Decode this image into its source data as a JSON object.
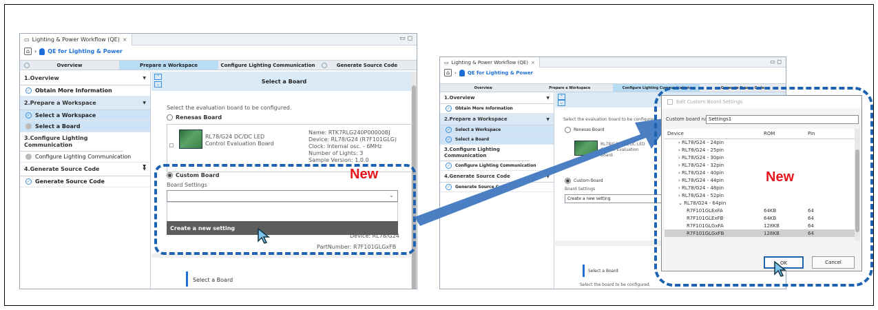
{
  "left": {
    "tab_title": "Lighting & Power Workflow (QE)",
    "tab_close": "×",
    "window_controls": "▭ ◻",
    "app_title": "QE for Lighting & Power",
    "steps": [
      "Overview",
      "Prepare a Workspace",
      "Configure Lighting Communication",
      "Generate Source Code"
    ],
    "sections": [
      {
        "label": "1.Overview",
        "items": [
          "Obtain More Information"
        ]
      },
      {
        "label": "2.Prepare a Workspace",
        "items": [
          "Select a Workspace",
          "Select a Board"
        ]
      },
      {
        "label": "3.Configure Lighting Communication",
        "items": [
          "Configure Lighting Communication"
        ]
      },
      {
        "label": "4.Generate Source Code",
        "items": [
          "Generate Source Code"
        ]
      }
    ],
    "header": "Select a Board",
    "instruction": "Select the evaluation board to be configured.",
    "renesas_board": "Renesas Board",
    "board_desc": "RL78/G24 DC/DC LED Control Evaluation Board",
    "board_info": [
      "Name: RTK7RLG240P00000BJ",
      "Device: RL78/G24 (R7F101GLG)",
      "Clock: Internal osc. - 6MHz",
      "Number of Lights: 3",
      "Sample Version: 1.0.0"
    ],
    "custom_board": "Custom Board",
    "board_settings": "Board Settings",
    "menu_item": "Create a new setting",
    "device_tail": "Device: RL78/G24",
    "part_number": "PartNumber: R7F101GLGxFB",
    "bottom_heading": "Select a Board",
    "new_label": "New"
  },
  "right": {
    "tab_title": "Lighting & Power Workflow (QE)",
    "tab_close": "×",
    "window_controls": "▭ ◻",
    "app_title": "QE for Lighting & Power",
    "steps": [
      "Overview",
      "Prepare a Workspace",
      "Configure Lighting Communication",
      "Generate Source Code"
    ],
    "sections": [
      {
        "label": "1.Overview",
        "items": [
          "Obtain More Information"
        ]
      },
      {
        "label": "2.Prepare a Workspace",
        "items": [
          "Select a Workspace",
          "Select a Board"
        ]
      },
      {
        "label": "3.Configure Lighting Communication",
        "items": [
          "Configure Lighting Communication"
        ]
      },
      {
        "label": "4.Generate Source Code",
        "items": [
          "Generate Source Code"
        ]
      }
    ],
    "instruction": "Select the evaluation board to be configured.",
    "renesas_board": "Renesas Board",
    "board_desc": "RL78/G24 DC/DC LED Control Evaluation Board",
    "custom_board": "Custom Board",
    "board_settings": "Board Settings",
    "dropdown_value": "Create a new setting",
    "bottom_heading": "Select a Board",
    "bottom_text": "Select the board to be configured."
  },
  "dialog": {
    "title": "Edit Custom Board Settings",
    "name_label": "Custom board name",
    "name_value": "Settings1",
    "columns": [
      "Device",
      "ROM",
      "Pin"
    ],
    "rows": [
      {
        "device": "› RL78/G24 - 24pin",
        "rom": "",
        "pin": ""
      },
      {
        "device": "› RL78/G24 - 25pin",
        "rom": "",
        "pin": ""
      },
      {
        "device": "› RL78/G24 - 30pin",
        "rom": "",
        "pin": ""
      },
      {
        "device": "› RL78/G24 - 32pin",
        "rom": "",
        "pin": ""
      },
      {
        "device": "› RL78/G24 - 40pin",
        "rom": "",
        "pin": ""
      },
      {
        "device": "› RL78/G24 - 44pin",
        "rom": "",
        "pin": ""
      },
      {
        "device": "› RL78/G24 - 48pin",
        "rom": "",
        "pin": ""
      },
      {
        "device": "› RL78/G24 - 52pin",
        "rom": "",
        "pin": ""
      },
      {
        "device": "⌄ RL78/G24 - 64pin",
        "rom": "",
        "pin": ""
      },
      {
        "device": "R7F101GLExFA",
        "rom": "64KB",
        "pin": "64"
      },
      {
        "device": "R7F101GLExFB",
        "rom": "64KB",
        "pin": "64"
      },
      {
        "device": "R7F101GLGxFA",
        "rom": "128KB",
        "pin": "64"
      },
      {
        "device": "R7F101GLGxFB",
        "rom": "128KB",
        "pin": "64"
      }
    ],
    "ok": "OK",
    "cancel": "Cancel",
    "new_label": "New"
  },
  "colors": {
    "accent": "#1e63b0",
    "new": "#e8151b",
    "arrow": "#4a7fc4"
  }
}
